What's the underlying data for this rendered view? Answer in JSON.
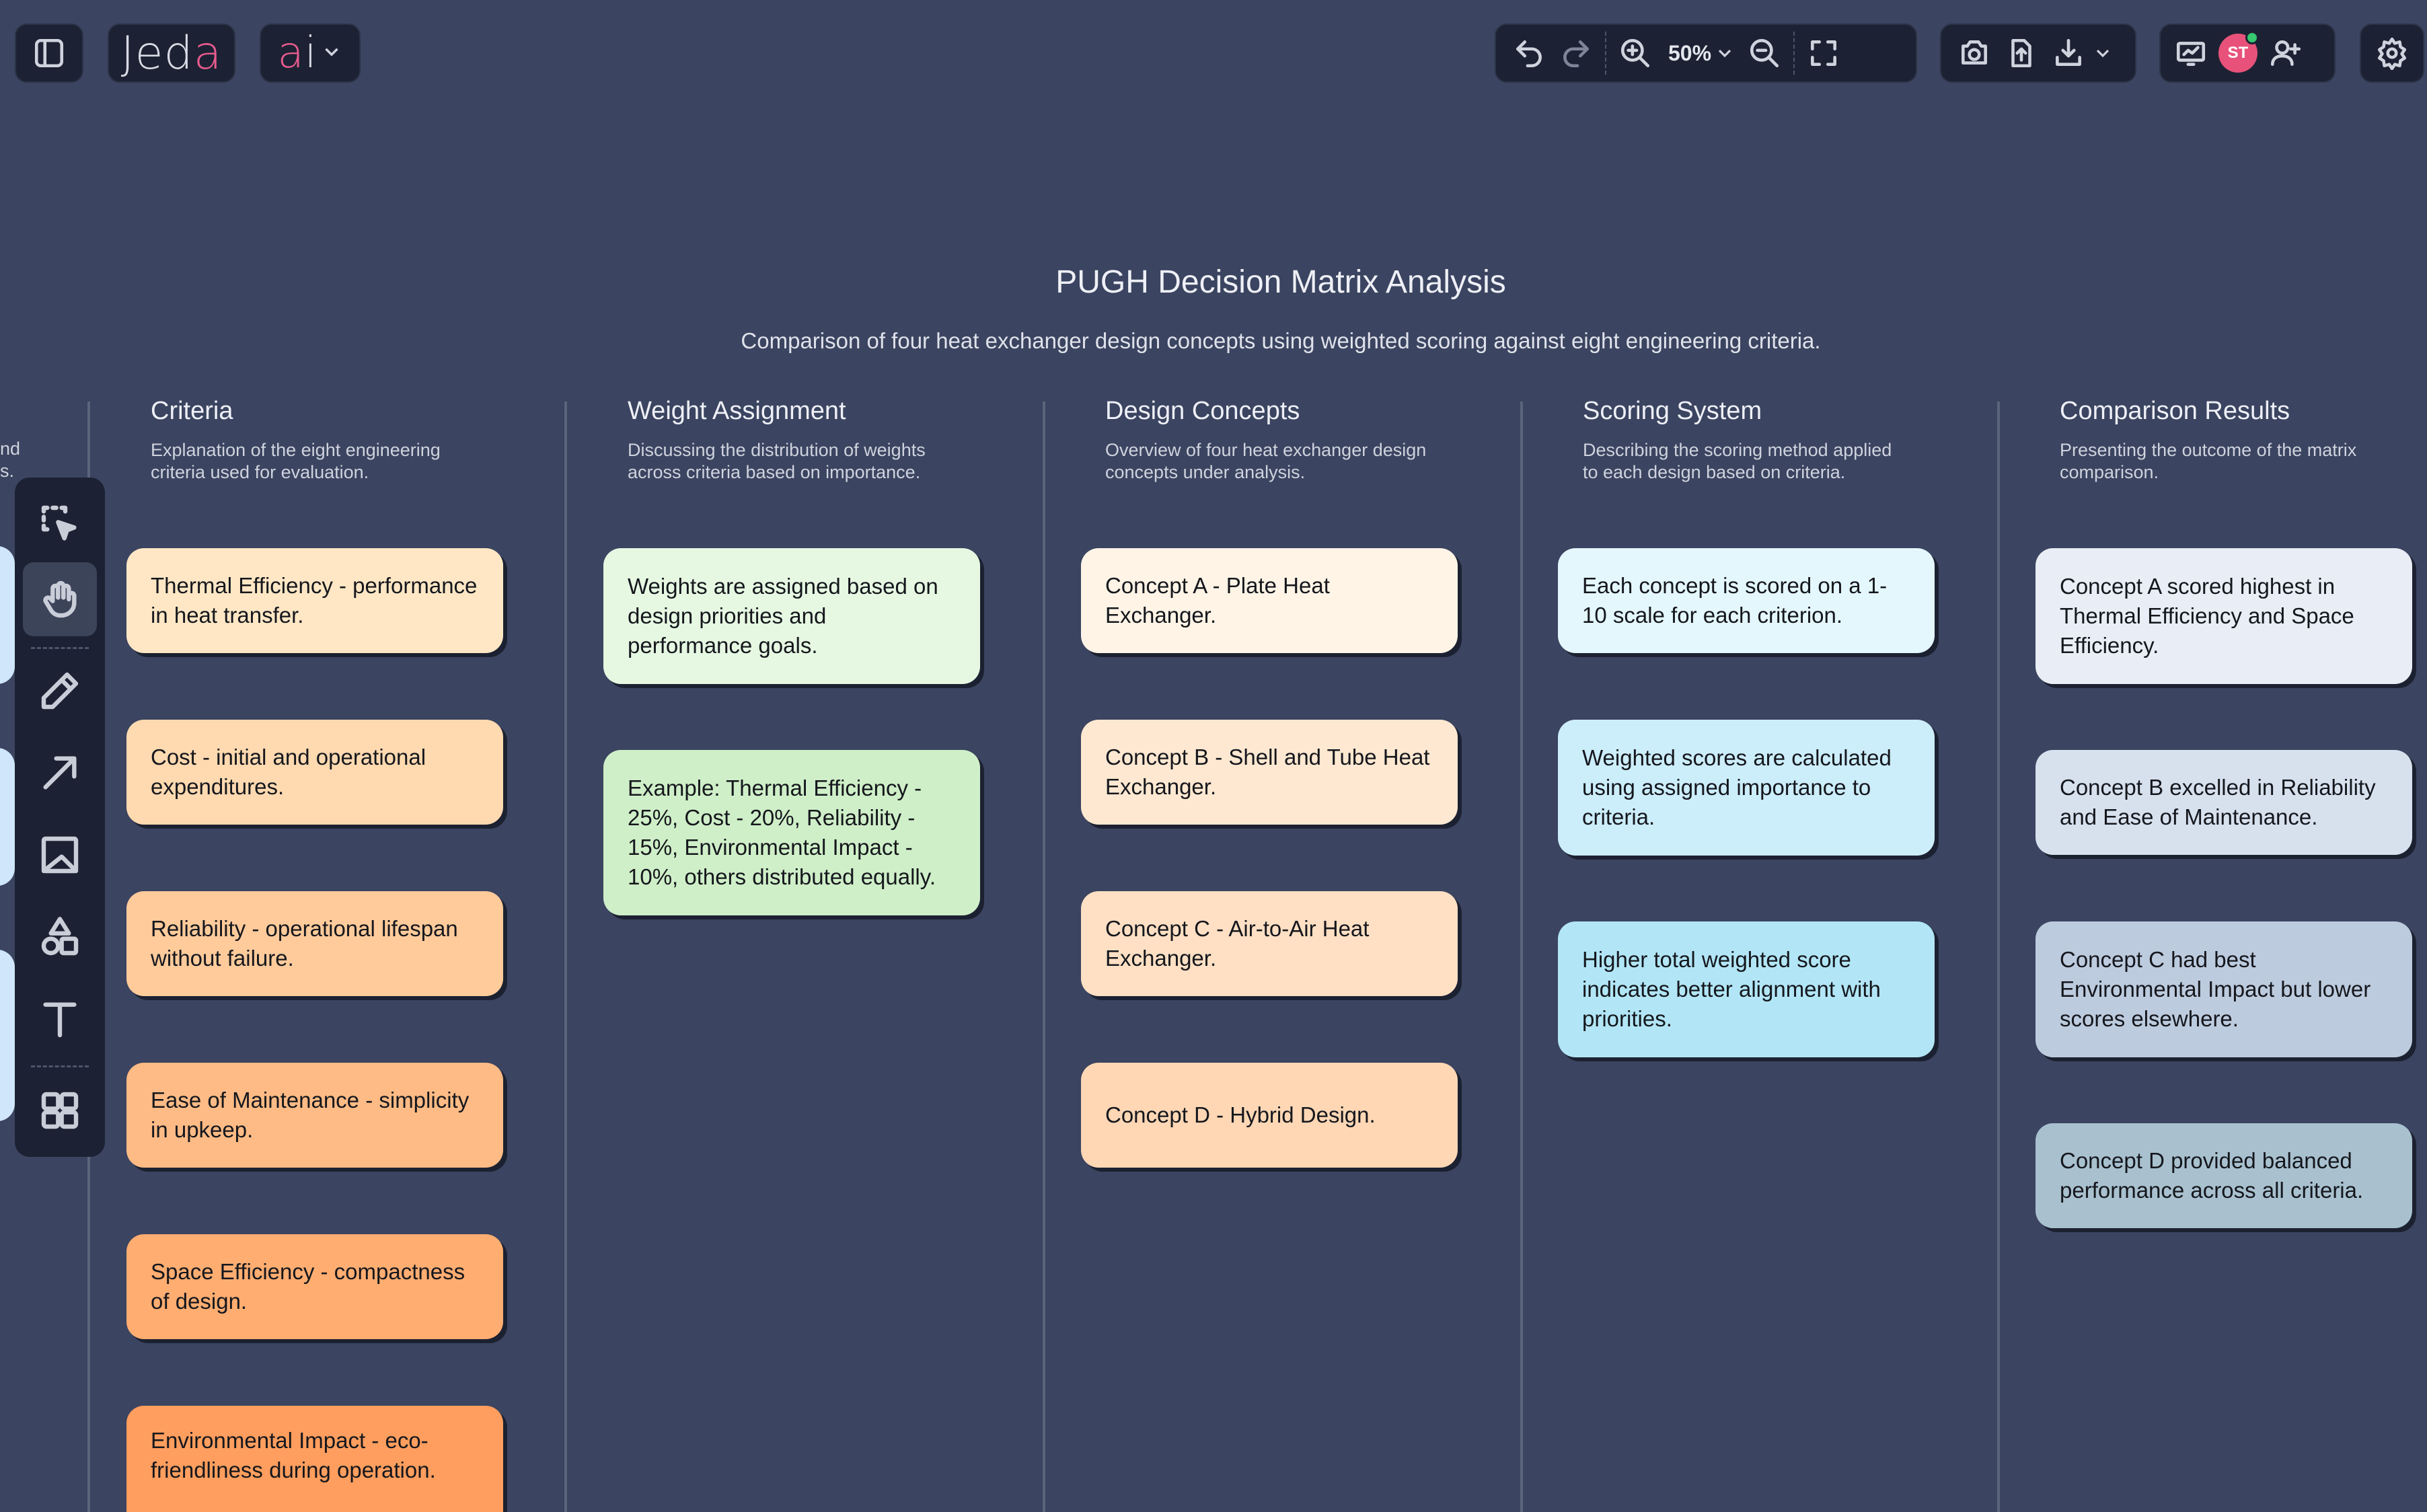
{
  "app": {
    "logo_main": "Jed",
    "logo_accent": "a",
    "ai_main": "a",
    "ai_accent": "i"
  },
  "toolbar": {
    "zoom": "50%",
    "user_initials": "ST"
  },
  "page": {
    "title": "PUGH Decision Matrix Analysis",
    "subtitle": "Comparison of four heat exchanger design concepts using weighted scoring against eight engineering criteria."
  },
  "offscreen_text": {
    "line1": "nd",
    "line2": "s."
  },
  "columns": [
    {
      "title": "Criteria",
      "desc": "Explanation of the eight engineering criteria used for evaluation.",
      "cards": [
        {
          "text": "Thermal Efficiency - performance in heat transfer.",
          "color": "#ffe7c5"
        },
        {
          "text": "Cost - initial and operational expenditures.",
          "color": "#ffd9b0"
        },
        {
          "text": "Reliability - operational lifespan without failure.",
          "color": "#ffcb9b"
        },
        {
          "text": "Ease of Maintenance - simplicity in upkeep.",
          "color": "#ffbb85"
        },
        {
          "text": "Space Efficiency - compactness of design.",
          "color": "#ffad71"
        },
        {
          "text": "Environmental Impact - eco-friendliness during operation.",
          "color": "#ff9e5e"
        }
      ]
    },
    {
      "title": "Weight Assignment",
      "desc": "Discussing the distribution of weights across criteria based on importance.",
      "cards": [
        {
          "text": "Weights are assigned based on design priorities and performance goals.",
          "color": "#e6f8e2"
        },
        {
          "text": "Example: Thermal Efficiency - 25%, Cost - 20%, Reliability - 15%, Environmental Impact - 10%, others distributed equally.",
          "color": "#cfefc8"
        }
      ]
    },
    {
      "title": "Design Concepts",
      "desc": "Overview of four heat exchanger design concepts under analysis.",
      "cards": [
        {
          "text": "Concept A - Plate Heat Exchanger.",
          "color": "#fff4e6"
        },
        {
          "text": "Concept B - Shell and Tube Heat Exchanger.",
          "color": "#ffe8d1"
        },
        {
          "text": "Concept C - Air-to-Air Heat Exchanger.",
          "color": "#ffe0c4"
        },
        {
          "text": "Concept D - Hybrid Design.",
          "color": "#ffd7b5"
        }
      ]
    },
    {
      "title": "Scoring System",
      "desc": "Describing the scoring method applied to each design based on criteria.",
      "cards": [
        {
          "text": "Each concept is scored on a 1-10 scale for each criterion.",
          "color": "#e4f7fd"
        },
        {
          "text": "Weighted scores are calculated using assigned importance to criteria.",
          "color": "#ccedfa"
        },
        {
          "text": "Higher total weighted score indicates better alignment with priorities.",
          "color": "#b2e6f6"
        }
      ]
    },
    {
      "title": "Comparison Results",
      "desc": "Presenting the outcome of the matrix comparison.",
      "cards": [
        {
          "text": "Concept A scored highest in Thermal Efficiency and Space Efficiency.",
          "color": "#e9eef6"
        },
        {
          "text": "Concept B excelled in Reliability and Ease of Maintenance.",
          "color": "#d7e1ee"
        },
        {
          "text": "Concept C had best Environmental Impact but lower scores elsewhere.",
          "color": "#bdcbde"
        },
        {
          "text": "Concept D provided balanced performance across all criteria.",
          "color": "#a9c1cf"
        }
      ]
    }
  ]
}
